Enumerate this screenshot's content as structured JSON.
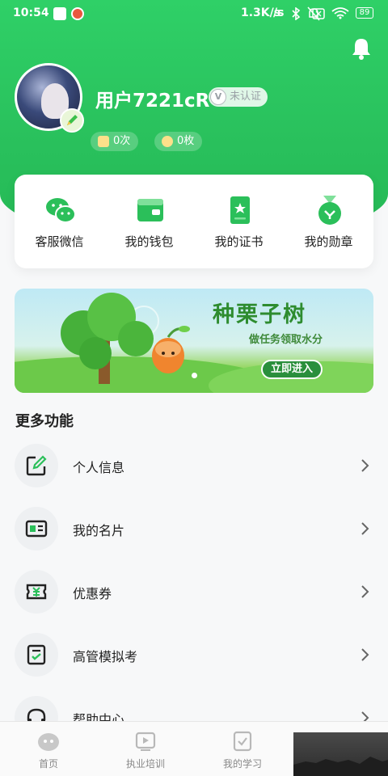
{
  "status_bar": {
    "time": "10:54",
    "network": "1.3K/s",
    "battery": "89"
  },
  "profile": {
    "username": "用户7221cR",
    "verify_badge": "V",
    "verify_text": "未认证",
    "stats": [
      {
        "value": "0次"
      },
      {
        "value": "0枚"
      }
    ]
  },
  "quick_actions": [
    {
      "label": "客服微信",
      "icon": "wechat-icon"
    },
    {
      "label": "我的钱包",
      "icon": "wallet-icon"
    },
    {
      "label": "我的证书",
      "icon": "certificate-icon"
    },
    {
      "label": "我的勋章",
      "icon": "medal-icon"
    }
  ],
  "banner": {
    "title": "种栗子树",
    "subtitle": "做任务领取水分",
    "button": "立即进入"
  },
  "more": {
    "title": "更多功能",
    "items": [
      {
        "label": "个人信息",
        "icon": "edit-icon"
      },
      {
        "label": "我的名片",
        "icon": "card-icon"
      },
      {
        "label": "优惠券",
        "icon": "coupon-icon"
      },
      {
        "label": "高管模拟考",
        "icon": "exam-icon"
      },
      {
        "label": "帮助中心",
        "icon": "headset-icon"
      }
    ]
  },
  "tabs": [
    {
      "label": "首页",
      "icon": "home-icon"
    },
    {
      "label": "执业培训",
      "icon": "video-icon"
    },
    {
      "label": "我的学习",
      "icon": "study-icon"
    }
  ],
  "colors": {
    "brand": "#29c05c",
    "accent_dark": "#2a8f3c",
    "text": "#222222",
    "muted": "#888888"
  }
}
